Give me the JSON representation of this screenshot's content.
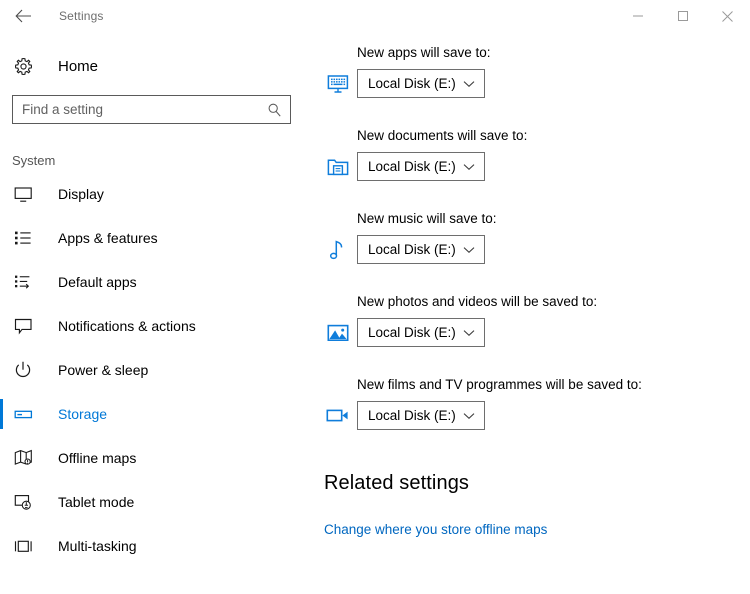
{
  "window": {
    "title": "Settings",
    "back_icon": "back-arrow-icon",
    "controls": {
      "minimize": "minimize-icon",
      "maximize": "maximize-icon",
      "close": "close-icon"
    }
  },
  "sidebar": {
    "home": {
      "label": "Home",
      "icon": "gear-icon"
    },
    "search": {
      "value": "",
      "placeholder": "Find a setting",
      "icon": "search-icon"
    },
    "section_header": "System",
    "items": [
      {
        "label": "Display",
        "icon": "monitor-icon",
        "selected": false
      },
      {
        "label": "Apps & features",
        "icon": "list-bullets-icon",
        "selected": false
      },
      {
        "label": "Default apps",
        "icon": "list-arrow-icon",
        "selected": false
      },
      {
        "label": "Notifications & actions",
        "icon": "speech-bubble-icon",
        "selected": false
      },
      {
        "label": "Power & sleep",
        "icon": "power-icon",
        "selected": false
      },
      {
        "label": "Storage",
        "icon": "drive-icon",
        "selected": true
      },
      {
        "label": "Offline maps",
        "icon": "map-icon",
        "selected": false
      },
      {
        "label": "Tablet mode",
        "icon": "tablet-hand-icon",
        "selected": false
      },
      {
        "label": "Multi-tasking",
        "icon": "multitask-window-icon",
        "selected": false
      }
    ]
  },
  "main": {
    "save_locations": [
      {
        "label": "New apps will save to:",
        "icon": "apps-monitor-icon",
        "value": "Local Disk (E:)",
        "chevron": "chevron-down-icon"
      },
      {
        "label": "New documents will save to:",
        "icon": "documents-folder-icon",
        "value": "Local Disk (E:)",
        "chevron": "chevron-down-icon"
      },
      {
        "label": "New music will save to:",
        "icon": "music-note-icon",
        "value": "Local Disk (E:)",
        "chevron": "chevron-down-icon"
      },
      {
        "label": "New photos and videos will be saved to:",
        "icon": "photos-picture-icon",
        "value": "Local Disk (E:)",
        "chevron": "chevron-down-icon"
      },
      {
        "label": "New films and TV programmes will be saved to:",
        "icon": "video-camera-icon",
        "value": "Local Disk (E:)",
        "chevron": "chevron-down-icon"
      }
    ],
    "related": {
      "heading": "Related settings",
      "link": "Change where you store offline maps"
    }
  },
  "colors": {
    "accent": "#0078d7",
    "link": "#0067c0",
    "icon_blue": "#0f7ddb",
    "text": "#000000",
    "muted": "#6e6e6e"
  }
}
